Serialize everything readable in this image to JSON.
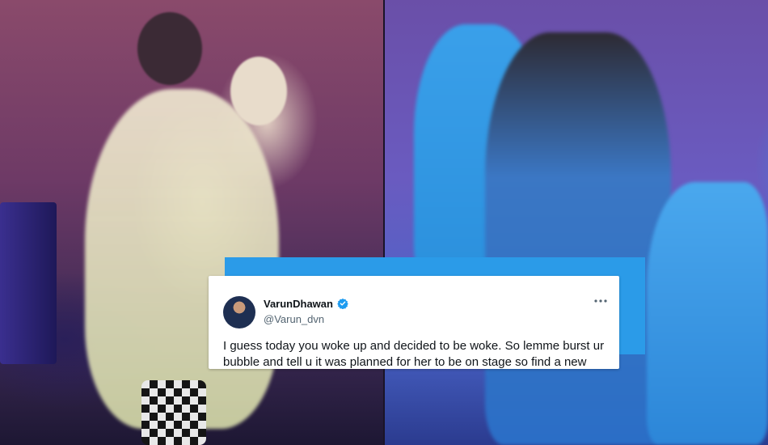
{
  "tweet": {
    "display_name": "VarunDhawan",
    "handle": "@Varun_dvn",
    "text": "I guess today you woke up and decided to be woke. So lemme burst ur bubble and tell u it was planned for her to be on stage so find a new",
    "verified_icon": "verified-badge-icon",
    "more_icon": "more-options-icon"
  },
  "colors": {
    "accent_block": "#2b9be8",
    "verified": "#1d9bf0",
    "text_primary": "#0f1419",
    "text_secondary": "#536471"
  },
  "photos": {
    "left": "stage-performance-left",
    "right": "stage-performance-right"
  }
}
